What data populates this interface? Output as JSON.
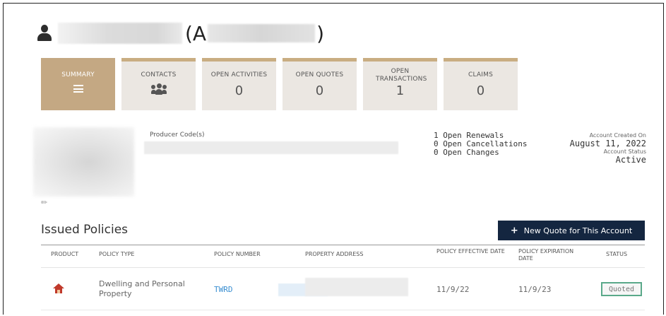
{
  "account": {
    "name_prefix": "(A",
    "name_suffix": ")"
  },
  "tiles": [
    {
      "label": "SUMMARY",
      "icon": "hamburger-icon",
      "active": true
    },
    {
      "label": "CONTACTS",
      "icon": "people-icon"
    },
    {
      "label": "OPEN ACTIVITIES",
      "count": "0"
    },
    {
      "label": "OPEN QUOTES",
      "count": "0"
    },
    {
      "label": "OPEN TRANSACTIONS",
      "count": "1"
    },
    {
      "label": "CLAIMS",
      "count": "0"
    }
  ],
  "producer": {
    "label": "Producer Code(s)"
  },
  "open_items": [
    "1 Open Renewals",
    "0 Open Cancellations",
    "0 Open Changes"
  ],
  "account_info": {
    "created_label": "Account Created On",
    "created_value": "August 11, 2022",
    "status_label": "Account Status",
    "status_value": "Active"
  },
  "issued_policies": {
    "title": "Issued Policies",
    "new_quote_label": "New Quote for This Account",
    "columns": [
      "PRODUCT",
      "POLICY TYPE",
      "POLICY NUMBER",
      "PROPERTY ADDRESS",
      "POLICY EFFECTIVE DATE",
      "POLICY EXPIRATION DATE",
      "STATUS"
    ],
    "rows": [
      {
        "product_icon": "house-icon",
        "policy_type": "Dwelling and Personal Property",
        "policy_number": "TWRD",
        "effective_date": "11/9/22",
        "expiration_date": "11/9/23",
        "status": "Quoted"
      }
    ]
  },
  "colors": {
    "tile_accent": "#c9ad82",
    "tile_active": "#c4a883",
    "button_bg": "#142640",
    "link": "#3b8fd1",
    "status_border": "#5aa98a",
    "product_icon": "#c0392b"
  }
}
